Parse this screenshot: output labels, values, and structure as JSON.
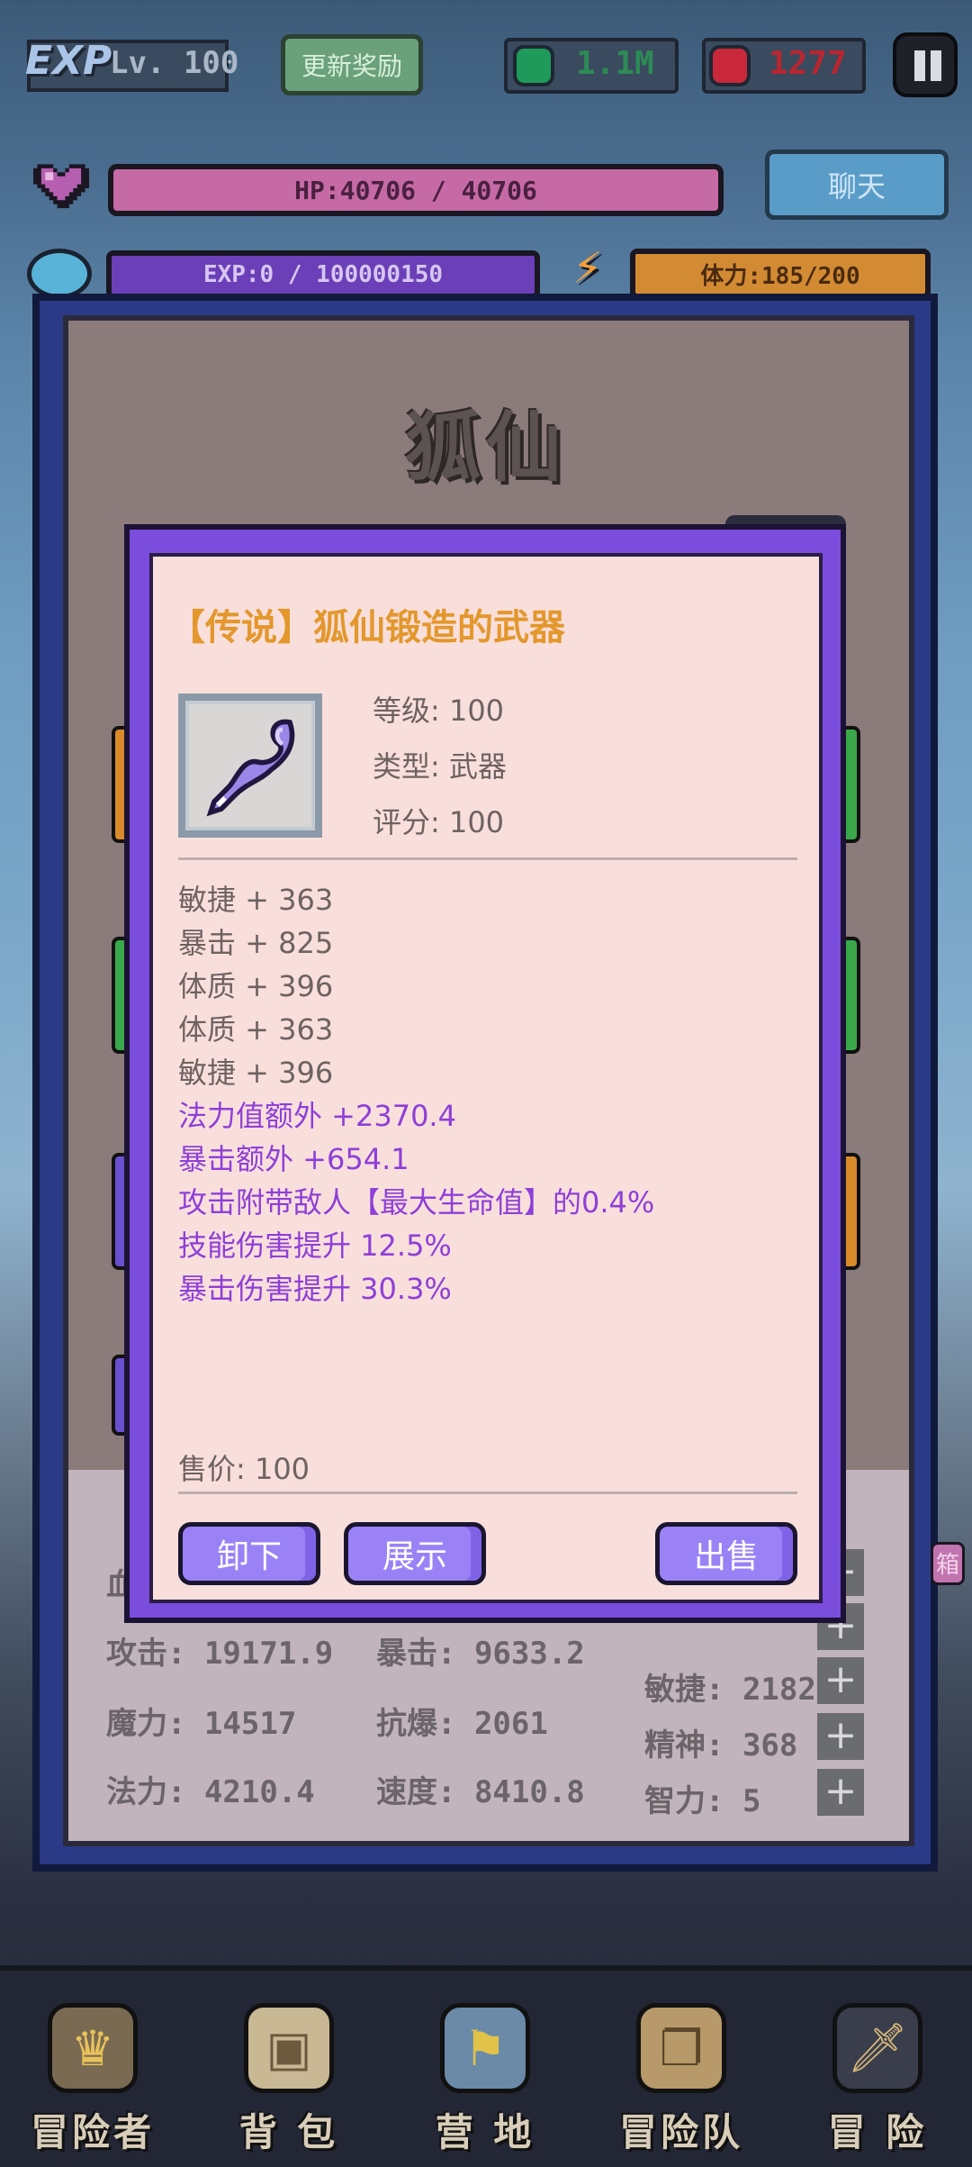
{
  "top_bar": {
    "exp_logo": "EXP",
    "level": "Lv. 100",
    "update_reward": "更新奖励",
    "emerald": "1.1M",
    "ruby": "1277"
  },
  "status": {
    "hp": "HP:40706 / 40706",
    "exp": "EXP:0 / 100000150",
    "stamina": "体力:185/200",
    "chat": "聊天"
  },
  "character": {
    "title": "狐仙",
    "stats_left": [
      {
        "label": "攻击: 19171.9"
      },
      {
        "label": "魔力: 14517"
      },
      {
        "label": "法力: 4210.4"
      }
    ],
    "stats_mid": [
      {
        "label": "暴击: 9633.2"
      },
      {
        "label": "抗爆: 2061"
      },
      {
        "label": "速度: 8410.8"
      }
    ],
    "stats_right": [
      {
        "label": "敏捷: 2182"
      },
      {
        "label": "精神: 368"
      },
      {
        "label": "智力: 5"
      }
    ],
    "hp_label_partial": "血",
    "side_tag_partial": "箱"
  },
  "item_modal": {
    "name": "【传说】狐仙锻造的武器",
    "level": "等级: 100",
    "type": "类型: 武器",
    "score": "评分: 100",
    "attributes": [
      {
        "text": "敏捷 + 363",
        "kind": "normal"
      },
      {
        "text": "暴击 + 825",
        "kind": "normal"
      },
      {
        "text": "体质 + 396",
        "kind": "normal"
      },
      {
        "text": "体质 + 363",
        "kind": "normal"
      },
      {
        "text": "敏捷 + 396",
        "kind": "normal"
      },
      {
        "text": "法力值额外 +2370.4",
        "kind": "special"
      },
      {
        "text": "暴击额外 +654.1",
        "kind": "special"
      },
      {
        "text": "攻击附带敌人【最大生命值】的0.4%",
        "kind": "special"
      },
      {
        "text": "技能伤害提升 12.5%",
        "kind": "special"
      },
      {
        "text": "暴击伤害提升 30.3%",
        "kind": "special"
      }
    ],
    "price": "售价: 100",
    "buttons": {
      "unequip": "卸下",
      "show": "展示",
      "sell": "出售"
    }
  },
  "bottom_nav": [
    {
      "label": "冒险者",
      "icon": "crown-icon"
    },
    {
      "label": "背 包",
      "icon": "backpack-icon"
    },
    {
      "label": "营 地",
      "icon": "camp-banner-icon"
    },
    {
      "label": "冒险队",
      "icon": "book-icon"
    },
    {
      "label": "冒 险",
      "icon": "sword-icon"
    }
  ],
  "colors": {
    "legendary_name": "#e3972c",
    "special_attr": "#8e3fd8",
    "modal_frame": "#7a4ddc",
    "hp_bar": "#c66aa6",
    "exp_bar": "#6b3fb8",
    "stamina_bar": "#d38b33"
  }
}
